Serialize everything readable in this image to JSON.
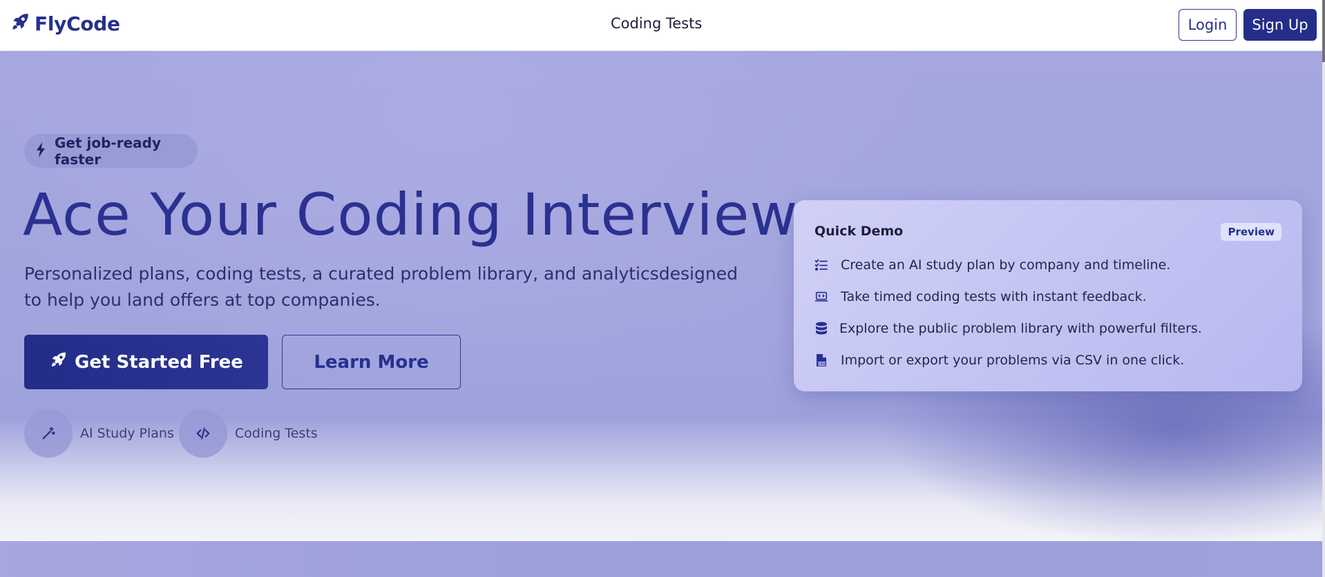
{
  "header": {
    "brand": "FlyCode",
    "nav_link": "Coding Tests",
    "login_label": "Login",
    "signup_label": "Sign Up"
  },
  "hero": {
    "pill_text": "Get job-ready faster",
    "headline": "Ace Your Coding Interviews",
    "subhead": "Personalized plans, coding tests, a curated problem library, and analyticsdesigned to help you land offers at top companies.",
    "primary_cta": "Get Started Free",
    "secondary_cta": "Learn More",
    "features": [
      {
        "label": "AI Study Plans",
        "icon": "magic-wand-icon"
      },
      {
        "label": "Coding Tests",
        "icon": "code-icon"
      }
    ]
  },
  "demo": {
    "title": "Quick Demo",
    "badge": "Preview",
    "items": [
      {
        "text": "Create an AI study plan by company and timeline.",
        "icon": "list-check-icon"
      },
      {
        "text": " Take timed coding tests with instant feedback.",
        "icon": "laptop-code-icon"
      },
      {
        "text": "Explore the public problem library with powerful filters.",
        "icon": "database-icon"
      },
      {
        "text": "Import or export your problems via CSV in one click.",
        "icon": "file-csv-icon"
      }
    ]
  },
  "colors": {
    "brand": "#25308f",
    "hero_bg": "#a5a7de",
    "card_bg": "#c3c4f3"
  }
}
